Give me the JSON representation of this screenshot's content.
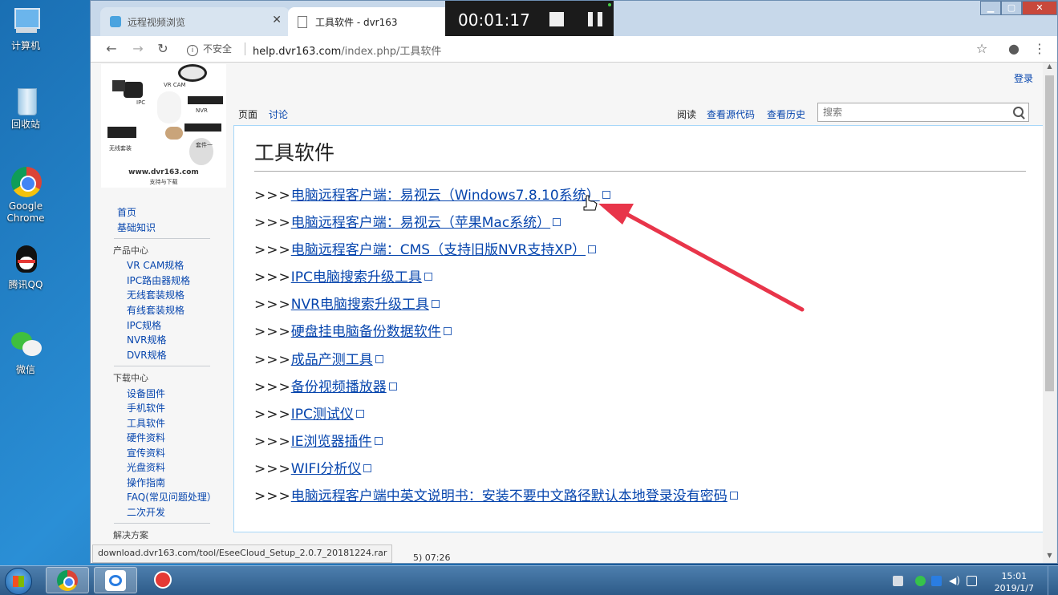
{
  "desktop": {
    "icons": [
      {
        "label": "计算机",
        "icon": "computer-icon"
      },
      {
        "label": "回收站",
        "icon": "recycle-bin-icon"
      },
      {
        "label": "Google Chrome",
        "icon": "chrome-icon"
      },
      {
        "label": "腾讯QQ",
        "icon": "qq-icon"
      },
      {
        "label": "微信",
        "icon": "wechat-icon"
      }
    ]
  },
  "browser": {
    "tabs": [
      {
        "title": "远程视频浏览",
        "icon": "remote-video-icon"
      },
      {
        "title": "工具软件 - dvr163",
        "icon": "page-icon"
      }
    ],
    "recorder": {
      "time": "00:01:17"
    },
    "address": {
      "security": "不安全",
      "host": "help.dvr163.com",
      "path": "/index.php/工具软件"
    },
    "status_url": "download.dvr163.com/tool/EseeCloud_Setup_2.0.7_20181224.rar",
    "footer_fragment": "5) 07:26"
  },
  "page": {
    "login": "登录",
    "tabs_left": [
      "页面",
      "讨论"
    ],
    "tabs_right": [
      "阅读",
      "查看源代码",
      "查看历史"
    ],
    "search_placeholder": "搜索",
    "title": "工具软件",
    "link_prefix": ">>>",
    "links": [
      "电脑远程客户端：易视云（Windows7.8.10系统）",
      "电脑远程客户端：易视云（苹果Mac系统）",
      "电脑远程客户端：CMS（支持旧版NVR支持XP）",
      "IPC电脑搜索升级工具",
      "NVR电脑搜索升级工具",
      "硬盘挂电脑备份数据软件",
      "成品产测工具",
      "备份视频播放器",
      "IPC测试仪",
      "IE浏览器插件",
      "WIFI分析仪",
      "电脑远程客户端中英文说明书：安装不要中文路径默认本地登录没有密码"
    ],
    "logo": {
      "labels": [
        "VR CAM",
        "IPC",
        "NVR",
        "无线套装",
        "套件一"
      ],
      "site": "www.dvr163.com",
      "tagline": "支持与下载"
    }
  },
  "sidebar": {
    "top": [
      "首页",
      "基础知识"
    ],
    "product_head": "产品中心",
    "products": [
      "VR CAM规格",
      "IPC路由器规格",
      "无线套装规格",
      "有线套装规格",
      "IPC规格",
      "NVR规格",
      "DVR规格"
    ],
    "download_head": "下载中心",
    "downloads": [
      "设备固件",
      "手机软件",
      "工具软件",
      "硬件资料",
      "宣传资料",
      "光盘资料",
      "操作指南",
      "FAQ(常见问题处理）",
      "二次开发"
    ],
    "solution_head": "解决方案"
  },
  "taskbar": {
    "apps": [
      "chrome-icon",
      "baidu-netdisk-icon",
      "recorder-icon"
    ],
    "clock_time": "15:01",
    "clock_date": "2019/1/7"
  },
  "colors": {
    "link": "#0645ad",
    "annotation_arrow": "#e8354a"
  }
}
